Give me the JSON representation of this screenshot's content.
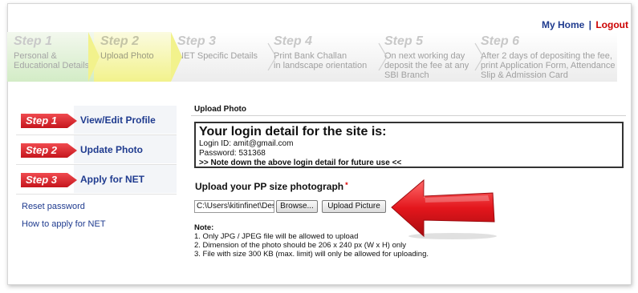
{
  "top_links": {
    "home": "My Home",
    "separator": "|",
    "logout": "Logout"
  },
  "steps": [
    {
      "num": "Step 1",
      "lines": [
        "Personal &",
        "Educational Details"
      ]
    },
    {
      "num": "Step 2",
      "lines": [
        "Upload Photo"
      ]
    },
    {
      "num": "Step 3",
      "lines": [
        "NET Specific Details"
      ]
    },
    {
      "num": "Step 4",
      "lines": [
        "Print Bank Challan",
        "in landscape orientation"
      ]
    },
    {
      "num": "Step 5",
      "lines": [
        "On next working day",
        "deposit the fee at any",
        "SBI Branch"
      ]
    },
    {
      "num": "Step 6",
      "lines": [
        "After 2 days of depositing the fee,",
        "print Application Form, Attendance",
        "Slip & Admission Card"
      ]
    }
  ],
  "nav": [
    {
      "badge": "Step 1",
      "label": "View/Edit Profile"
    },
    {
      "badge": "Step 2",
      "label": "Update Photo"
    },
    {
      "badge": "Step 3",
      "label": "Apply for NET"
    }
  ],
  "links": [
    "Reset password",
    "How to apply for NET"
  ],
  "main": {
    "title": "Upload Photo",
    "login_heading": "Your login detail for the site is:",
    "login_id": "Login ID: amit@gmail.com",
    "password": "Password: 531368",
    "login_note": ">> Note down the above login detail for future use <<",
    "upload_heading": "Upload your PP size photograph",
    "required_mark": "*",
    "file_value": "C:\\Users\\kitinfinet\\Des",
    "browse_label": "Browse...",
    "upload_label": "Upload Picture",
    "note_heading": "Note:",
    "notes": [
      "1. Only JPG / JPEG file will be allowed to upload",
      "2. Dimension of the photo should be 206 x 240 px (W x H) only",
      "3. File with size 300 KB (max. limit) will only be allowed for uploading."
    ]
  },
  "colors": {
    "link": "#1f3b8f",
    "logout": "#cc0000",
    "badge": "#d8232a",
    "step1_bg": "#d3ecc6",
    "step2_bg": "#f2f28c"
  }
}
